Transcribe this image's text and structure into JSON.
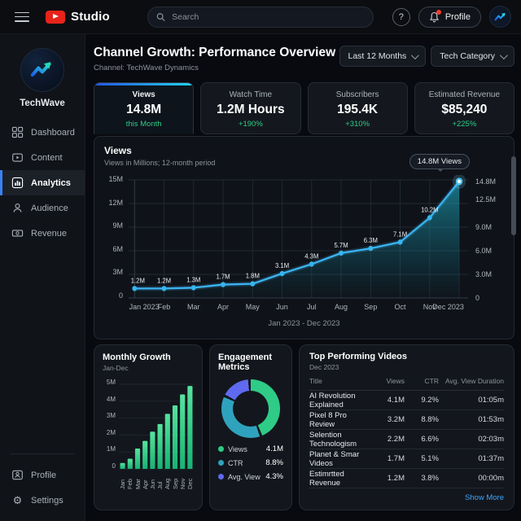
{
  "topbar": {
    "brand": "Studio",
    "search_placeholder": "Search",
    "profile_label": "Profile"
  },
  "icons": {
    "menu": "hamburger",
    "brand": "youtube-play",
    "search": "magnifier",
    "help": "?",
    "notifications": "bell-with-red-dot",
    "channel_logo": "blue-zigzag-arrow",
    "dashboard": "grid-squares",
    "content": "video-box",
    "analytics": "bar-chart",
    "audience": "person",
    "revenue": "banknote",
    "profile": "id-card",
    "settings": "gear"
  },
  "sidebar": {
    "channel_name": "TechWave",
    "items": [
      {
        "label": "Dashboard",
        "active": false
      },
      {
        "label": "Content",
        "active": false
      },
      {
        "label": "Analytics",
        "active": true
      },
      {
        "label": "Audience",
        "active": false
      },
      {
        "label": "Revenue",
        "active": false
      }
    ],
    "footer_items": [
      {
        "label": "Profile"
      },
      {
        "label": "Settings"
      }
    ]
  },
  "header": {
    "title": "Channel Growth: Performance Overview",
    "subtitle": "Channel: TechWave Dynamics",
    "filters": [
      {
        "label": "Last 12 Months"
      },
      {
        "label": "Tech Category"
      }
    ]
  },
  "stats": [
    {
      "label": "Views",
      "value": "14.8M",
      "delta": "this Month",
      "active": true
    },
    {
      "label": "Watch Time",
      "value": "1.2M Hours",
      "delta": "+190%",
      "active": false
    },
    {
      "label": "Subscribers",
      "value": "195.4K",
      "delta": "+310%",
      "active": false
    },
    {
      "label": "Estimated Revenue",
      "value": "$85,240",
      "delta": "+225%",
      "active": false
    }
  ],
  "main_chart": {
    "title": "Views",
    "subtitle": "Views in Millions; 12-month period",
    "badge": "14.8M Views",
    "footer": "Jan 2023 - Dec 2023"
  },
  "colors": {
    "accent_blue": "#3db4f2",
    "accent_cyan": "#22d3ee",
    "green": "#2ecc87",
    "teal": "#2fa3bd",
    "purple": "#5f6af0",
    "link_blue": "#3ea6ff",
    "youtube_red": "#e8231a"
  },
  "chart_data": [
    {
      "type": "area",
      "title": "Views",
      "x": [
        "Jan 2023",
        "Feb",
        "Mar",
        "Apr",
        "May",
        "Jun",
        "Jul",
        "Aug",
        "Sep",
        "Oct",
        "Nov",
        "Dec 2023"
      ],
      "values": [
        1.2,
        1.2,
        1.3,
        1.7,
        1.8,
        3.1,
        4.3,
        5.7,
        6.3,
        7.1,
        10.2,
        14.8
      ],
      "point_labels": [
        "1.2M",
        "1.2M",
        "1.3M",
        "1.7M",
        "1.8M",
        "3.1M",
        "4.3M",
        "5.7M",
        "6.3M",
        "7.1M",
        "10.2M",
        ""
      ],
      "yticks_left": [
        "15M",
        "12M",
        "9M",
        "6M",
        "3M",
        "0"
      ],
      "yticks_right": [
        {
          "label": "14.8M",
          "v": 14.8
        },
        {
          "label": "12.5M",
          "v": 12.5
        },
        {
          "label": "9.0M",
          "v": 9.0
        },
        {
          "label": "6.0M",
          "v": 6.0
        },
        {
          "label": "3.0M",
          "v": 3.0
        },
        {
          "label": "0",
          "v": 0
        }
      ],
      "ylim": [
        0,
        15
      ],
      "line_color": "#3db4f2",
      "legend_position": "none",
      "grid": true
    },
    {
      "type": "bar",
      "title": "Monthly Growth",
      "subtitle": "Jan-Dec",
      "categories": [
        "Jan",
        "Feb",
        "Mar",
        "Apr",
        "Jun",
        "Jul",
        "Aug",
        "Sep",
        "Nov",
        "Dec"
      ],
      "values": [
        0.35,
        0.6,
        1.2,
        1.65,
        2.2,
        2.65,
        3.25,
        3.75,
        4.4,
        4.9
      ],
      "yticks": [
        "5M",
        "4M",
        "3M",
        "2M",
        "1M",
        "0"
      ],
      "ylim": [
        0,
        5
      ],
      "bar_color_top": "#56e39f",
      "bar_color_bottom": "#17b374",
      "grid": true
    },
    {
      "type": "pie",
      "title": "Engagement Metrics",
      "slices": [
        {
          "label": "Views",
          "value": "4.1M",
          "pct": 45,
          "color": "#2ecc87"
        },
        {
          "label": "CTR",
          "value": "8.8%",
          "pct": 38,
          "color": "#2fa3bd"
        },
        {
          "label": "Avg. View",
          "value": "4.3%",
          "pct": 17,
          "color": "#5f6af0"
        }
      ],
      "donut": true
    },
    {
      "type": "table",
      "title": "Top Performing Videos",
      "subtitle": "Dec 2023",
      "columns": [
        "Title",
        "Views",
        "CTR",
        "Avg. View Duration"
      ],
      "rows": [
        [
          "AI Revolution Explained",
          "4.1M",
          "9.2%",
          "01:05m"
        ],
        [
          "Pixel 8 Pro Review",
          "3.2M",
          "8.8%",
          "01:53m"
        ],
        [
          "Selention Technologism",
          "2.2M",
          "6.6%",
          "02:03m"
        ],
        [
          "Planet & Smar Videos",
          "1.7M",
          "5.1%",
          "01:37m"
        ],
        [
          "Estimrtted Revenue",
          "1.2M",
          "3.8%",
          "00:00m"
        ]
      ],
      "footer_link": "Show More"
    }
  ]
}
